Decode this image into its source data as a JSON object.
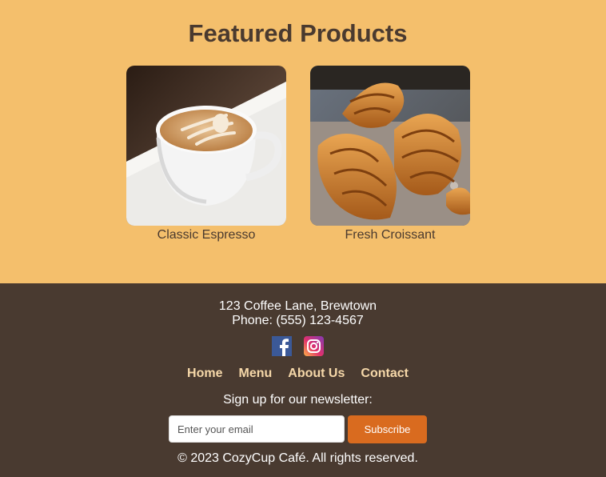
{
  "featured": {
    "title": "Featured Products",
    "products": [
      {
        "name": "Classic Espresso",
        "image": "latte-art-coffee-cup"
      },
      {
        "name": "Fresh Croissant",
        "image": "croissants"
      }
    ]
  },
  "footer": {
    "address": "123 Coffee Lane, Brewtown",
    "phone": "Phone: (555) 123-4567",
    "social": [
      "facebook-icon",
      "instagram-icon"
    ],
    "nav": [
      "Home",
      "Menu",
      "About Us",
      "Contact"
    ],
    "newsletter": {
      "label": "Sign up for our newsletter:",
      "placeholder": "Enter your email",
      "button": "Subscribe"
    },
    "copyright": "© 2023 CozyCup Café. All rights reserved."
  },
  "colors": {
    "featured_bg": "#f4bf6c",
    "footer_bg": "#493a30",
    "nav_link": "#f6d8a9",
    "accent": "#d96b1f"
  }
}
